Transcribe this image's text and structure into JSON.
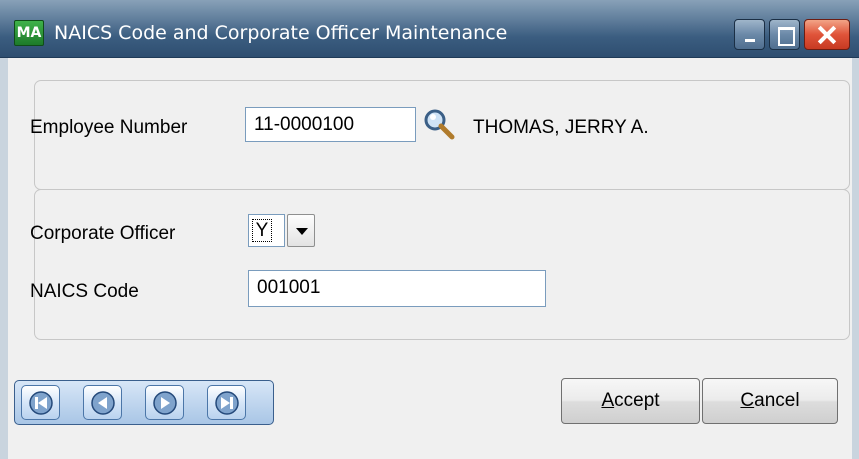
{
  "window": {
    "title": "NAICS Code and Corporate Officer Maintenance",
    "app_icon_text": "MA",
    "controls": [
      "minimize",
      "maximize",
      "close"
    ]
  },
  "employee": {
    "label": "Employee Number",
    "number": "11-0000100",
    "lookup_icon": "magnifier-icon",
    "name": "THOMAS, JERRY A."
  },
  "details": {
    "corporate_officer_label": "Corporate Officer",
    "corporate_officer_value": "Y",
    "naics_label": "NAICS Code",
    "naics_value": "001001"
  },
  "navigation": {
    "buttons": [
      "first-record-icon",
      "previous-record-icon",
      "next-record-icon",
      "last-record-icon"
    ]
  },
  "actions": {
    "accept_first": "A",
    "accept_rest": "ccept",
    "cancel_first": "C",
    "cancel_rest": "ancel"
  },
  "colors": {
    "titlebar": "#4a6b8e",
    "client_bg": "#f0f0f0",
    "close_button": "#e0543a"
  }
}
